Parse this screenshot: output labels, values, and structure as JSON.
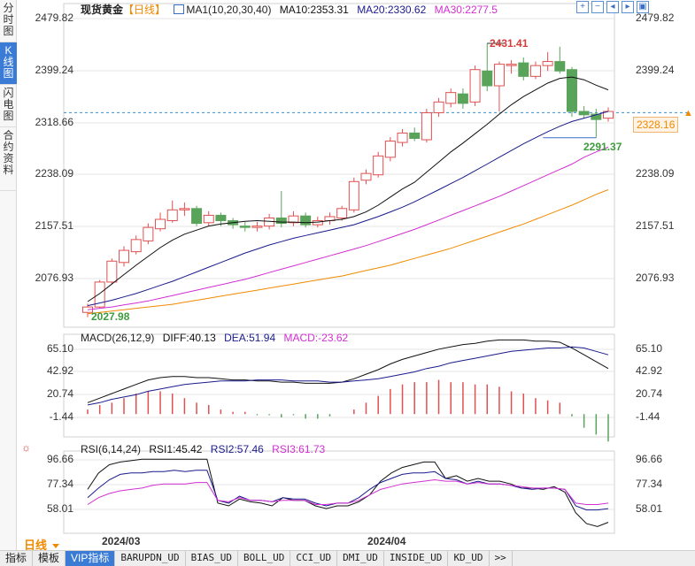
{
  "sidebar": {
    "tabs": [
      {
        "label": "分时图",
        "active": false
      },
      {
        "label": "K线图",
        "active": true
      },
      {
        "label": "闪电图",
        "active": false
      },
      {
        "label": "合约资料",
        "active": false
      }
    ]
  },
  "header": {
    "title": "现货黄金",
    "period_tag": "【日线】",
    "ma_label": "MA1(10,20,30,40)",
    "ma10": "MA10:2353.31",
    "ma20": "MA20:2330.62",
    "ma30": "MA30:2277.5"
  },
  "toolbar_icons": [
    "zoom-in-icon",
    "zoom-out-icon",
    "arrow-left-icon",
    "arrow-right-icon",
    "fullscreen-icon"
  ],
  "price_axis": {
    "left": [
      "2479.82",
      "2399.24",
      "2318.66",
      "2238.09",
      "2157.51",
      "2076.93"
    ],
    "right": [
      "2479.82",
      "2399.24",
      "2318.66",
      "2238.09",
      "2157.51",
      "2076.93"
    ],
    "current": "2328.16"
  },
  "annotations": {
    "high": "2431.41",
    "low": "2027.98",
    "recent_low": "2291.37"
  },
  "macd": {
    "label": "MACD(26,12,9)",
    "diff": "DIFF:40.13",
    "dea": "DEA:51.94",
    "macd": "MACD:-23.62",
    "axis": [
      "65.10",
      "42.92",
      "20.74",
      "-1.44"
    ]
  },
  "rsi": {
    "label": "RSI(6,14,24)",
    "rsi1": "RSI1:45.42",
    "rsi2": "RSI2:57.46",
    "rsi3": "RSI3:61.73",
    "axis": [
      "96.66",
      "77.34",
      "58.01"
    ]
  },
  "period_bar": {
    "period": "日线",
    "dates": [
      "2024/03",
      "2024/04"
    ]
  },
  "bottom_tabs": [
    {
      "label": "指标",
      "active": false,
      "cn": true
    },
    {
      "label": "模板",
      "active": false,
      "cn": true
    },
    {
      "label": "VIP指标",
      "active": true,
      "cn": true
    },
    {
      "label": "BARUPDN_UD",
      "active": false
    },
    {
      "label": "BIAS_UD",
      "active": false
    },
    {
      "label": "BOLL_UD",
      "active": false
    },
    {
      "label": "CCI_UD",
      "active": false
    },
    {
      "label": "DMI_UD",
      "active": false
    },
    {
      "label": "INSIDE_UD",
      "active": false
    },
    {
      "label": "KD_UD",
      "active": false
    },
    {
      "label": ">>",
      "active": false
    }
  ],
  "colors": {
    "up": "#e05050",
    "down": "#5aa35a",
    "ma10": "#111111",
    "ma20": "#1a1a8c",
    "ma30": "#d22fd2",
    "ma40": "#f08a00",
    "grid": "#e6e6e6",
    "accent": "#3a7bd5"
  },
  "chart_data": {
    "type": "candlestick",
    "price_range": [
      2010,
      2490
    ],
    "candles": [
      [
        2032,
        2040,
        2045,
        2025
      ],
      [
        2040,
        2077,
        2080,
        2038
      ],
      [
        2077,
        2108,
        2112,
        2074
      ],
      [
        2106,
        2124,
        2130,
        2100
      ],
      [
        2122,
        2140,
        2146,
        2118
      ],
      [
        2138,
        2158,
        2164,
        2133
      ],
      [
        2156,
        2170,
        2180,
        2152
      ],
      [
        2168,
        2184,
        2198,
        2165
      ],
      [
        2184,
        2186,
        2195,
        2175
      ],
      [
        2186,
        2164,
        2190,
        2160
      ],
      [
        2165,
        2176,
        2182,
        2160
      ],
      [
        2176,
        2168,
        2180,
        2160
      ],
      [
        2168,
        2162,
        2172,
        2156
      ],
      [
        2160,
        2158,
        2166,
        2152
      ],
      [
        2158,
        2160,
        2166,
        2152
      ],
      [
        2160,
        2172,
        2178,
        2155
      ],
      [
        2172,
        2164,
        2212,
        2158
      ],
      [
        2165,
        2175,
        2182,
        2160
      ],
      [
        2175,
        2162,
        2180,
        2158
      ],
      [
        2162,
        2168,
        2174,
        2158
      ],
      [
        2168,
        2174,
        2180,
        2162
      ],
      [
        2172,
        2186,
        2190,
        2168
      ],
      [
        2184,
        2226,
        2232,
        2180
      ],
      [
        2228,
        2238,
        2244,
        2222
      ],
      [
        2236,
        2264,
        2270,
        2232
      ],
      [
        2262,
        2286,
        2292,
        2256
      ],
      [
        2284,
        2298,
        2304,
        2278
      ],
      [
        2298,
        2290,
        2306,
        2286
      ],
      [
        2288,
        2328,
        2334,
        2284
      ],
      [
        2328,
        2344,
        2350,
        2322
      ],
      [
        2342,
        2358,
        2364,
        2336
      ],
      [
        2356,
        2342,
        2364,
        2334
      ],
      [
        2344,
        2392,
        2398,
        2338
      ],
      [
        2390,
        2368,
        2431,
        2360
      ],
      [
        2368,
        2400,
        2404,
        2330
      ],
      [
        2398,
        2400,
        2406,
        2386
      ],
      [
        2402,
        2382,
        2410,
        2376
      ],
      [
        2382,
        2398,
        2404,
        2378
      ],
      [
        2398,
        2404,
        2418,
        2390
      ],
      [
        2404,
        2390,
        2426,
        2386
      ],
      [
        2392,
        2330,
        2396,
        2322
      ],
      [
        2330,
        2325,
        2338,
        2320
      ],
      [
        2326,
        2318,
        2334,
        2291
      ],
      [
        2320,
        2330,
        2336,
        2315
      ]
    ],
    "ma10": [
      2048,
      2060,
      2074,
      2088,
      2102,
      2115,
      2128,
      2139,
      2148,
      2154,
      2160,
      2163,
      2165,
      2167,
      2168,
      2167,
      2166,
      2166,
      2165,
      2166,
      2168,
      2170,
      2174,
      2181,
      2191,
      2203,
      2215,
      2225,
      2240,
      2255,
      2270,
      2283,
      2297,
      2311,
      2326,
      2340,
      2352,
      2362,
      2372,
      2379,
      2381,
      2377,
      2369,
      2362
    ],
    "ma20": [
      2042,
      2046,
      2050,
      2055,
      2060,
      2066,
      2072,
      2078,
      2085,
      2092,
      2099,
      2106,
      2113,
      2120,
      2126,
      2132,
      2137,
      2142,
      2146,
      2150,
      2154,
      2158,
      2162,
      2168,
      2174,
      2181,
      2188,
      2196,
      2205,
      2214,
      2223,
      2232,
      2242,
      2252,
      2262,
      2272,
      2282,
      2291,
      2300,
      2308,
      2315,
      2320,
      2325,
      2330
    ],
    "ma30": [
      2036,
      2038,
      2040,
      2043,
      2046,
      2049,
      2053,
      2057,
      2061,
      2065,
      2069,
      2073,
      2077,
      2081,
      2086,
      2091,
      2096,
      2101,
      2106,
      2111,
      2116,
      2121,
      2126,
      2131,
      2137,
      2143,
      2149,
      2155,
      2162,
      2169,
      2176,
      2183,
      2190,
      2197,
      2204,
      2212,
      2220,
      2228,
      2236,
      2244,
      2252,
      2262,
      2270,
      2277
    ],
    "ma40": [
      2030,
      2032,
      2034,
      2036,
      2038,
      2040,
      2042,
      2044,
      2047,
      2050,
      2053,
      2056,
      2059,
      2062,
      2065,
      2068,
      2071,
      2074,
      2077,
      2080,
      2083,
      2086,
      2090,
      2094,
      2098,
      2102,
      2107,
      2112,
      2117,
      2122,
      2127,
      2133,
      2139,
      2145,
      2151,
      2157,
      2163,
      2170,
      2177,
      2184,
      2191,
      2199,
      2207,
      2214
    ],
    "macd_range": [
      -20,
      70
    ],
    "diff": [
      10,
      14,
      18,
      22,
      26,
      30,
      32,
      33,
      33,
      32,
      32,
      31,
      30,
      30,
      29,
      29,
      28,
      28,
      27,
      27,
      27,
      28,
      31,
      35,
      39,
      44,
      48,
      51,
      54,
      57,
      59,
      61,
      62,
      64,
      65,
      65,
      65,
      64,
      64,
      63,
      58,
      52,
      46,
      40
    ],
    "dea": [
      8,
      10,
      13,
      15,
      17,
      20,
      22,
      24,
      26,
      27,
      28,
      29,
      29,
      29,
      30,
      30,
      30,
      29,
      29,
      29,
      28,
      28,
      29,
      30,
      31,
      33,
      35,
      37,
      40,
      42,
      45,
      47,
      49,
      51,
      53,
      55,
      56,
      57,
      58,
      58,
      59,
      58,
      55,
      52
    ],
    "macd_hist": [
      4,
      8,
      10,
      14,
      18,
      20,
      20,
      18,
      14,
      10,
      8,
      4,
      2,
      2,
      -1,
      -1,
      -3,
      -1,
      -4,
      -4,
      -2,
      0,
      4,
      10,
      16,
      22,
      26,
      28,
      28,
      30,
      28,
      28,
      26,
      26,
      24,
      20,
      18,
      14,
      12,
      10,
      -2,
      -12,
      -18,
      -24
    ],
    "rsi_range": [
      40,
      100
    ],
    "rsi1": [
      72,
      84,
      90,
      92,
      93,
      94,
      94,
      94,
      94,
      94,
      94,
      94,
      62,
      60,
      65,
      63,
      62,
      60,
      66,
      64,
      64,
      60,
      58,
      60,
      60,
      63,
      68,
      78,
      84,
      88,
      90,
      92,
      92,
      80,
      82,
      78,
      80,
      78,
      78,
      76,
      73,
      73,
      72,
      74,
      70,
      55,
      47,
      45,
      48
    ],
    "rsi2": [
      66,
      73,
      79,
      83,
      84,
      84,
      85,
      85,
      86,
      85,
      86,
      86,
      64,
      62,
      67,
      64,
      64,
      63,
      66,
      65,
      65,
      62,
      60,
      62,
      62,
      66,
      72,
      77,
      80,
      83,
      84,
      84,
      85,
      80,
      79,
      76,
      78,
      76,
      76,
      75,
      73,
      72,
      73,
      73,
      72,
      60,
      57,
      57,
      58
    ],
    "rsi3": [
      61,
      66,
      69,
      71,
      72,
      73,
      75,
      76,
      76,
      76,
      77,
      77,
      64,
      63,
      66,
      64,
      64,
      63,
      64,
      64,
      64,
      61,
      61,
      62,
      62,
      64,
      68,
      72,
      74,
      76,
      77,
      78,
      79,
      78,
      78,
      76,
      77,
      76,
      76,
      75,
      74,
      73,
      73,
      73,
      72,
      62,
      61,
      61,
      62
    ]
  }
}
